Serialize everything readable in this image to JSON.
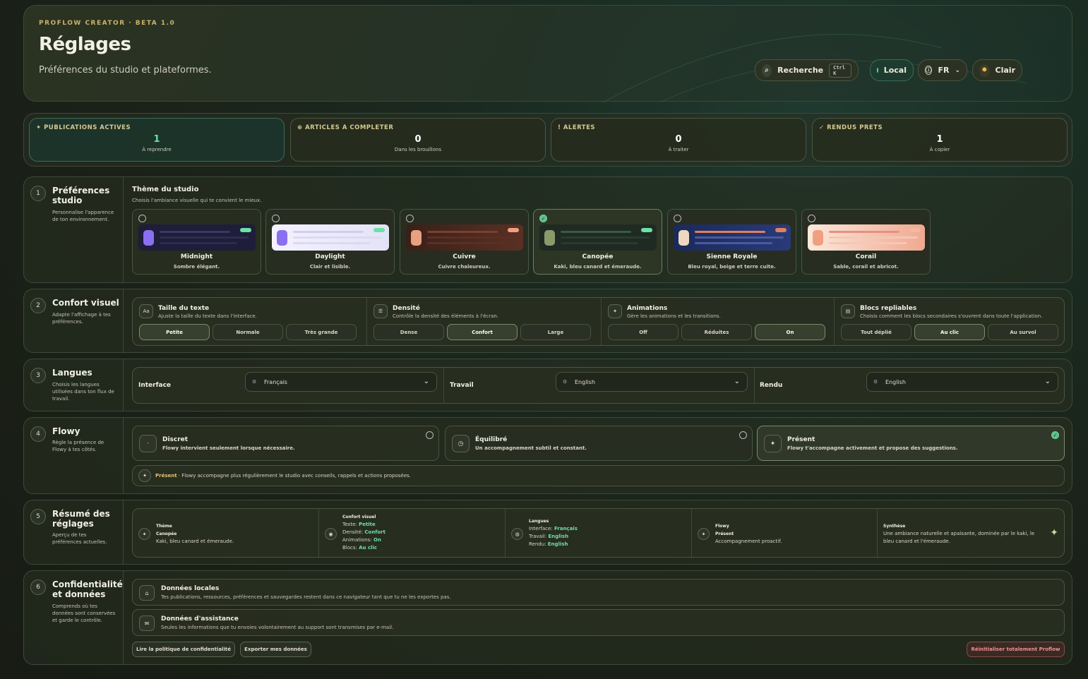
{
  "header": {
    "kicker": "PROFLOW CREATOR · BETA 1.0",
    "title": "Réglages",
    "subtitle": "Préférences du studio et plateformes.",
    "search_label": "Recherche",
    "search_shortcut": "Ctrl K",
    "local_label": "Local",
    "lang_label": "FR",
    "theme_label": "Clair"
  },
  "stats": [
    {
      "label": "✦ PUBLICATIONS ACTIVES",
      "value": "1",
      "note": "À reprendre"
    },
    {
      "label": "⊕ ARTICLES A COMPLETER",
      "value": "0",
      "note": "Dans les brouillons"
    },
    {
      "label": "! ALERTES",
      "value": "0",
      "note": "À traiter"
    },
    {
      "label": "✓ RENDUS PRETS",
      "value": "1",
      "note": "À copier"
    }
  ],
  "sections": {
    "s1": {
      "num": "1",
      "title": "Préférences studio",
      "desc": "Personnalise l'apparence de ton environnement."
    },
    "s2": {
      "num": "2",
      "title": "Confort visuel",
      "desc": "Adapte l'affichage à tes préférences."
    },
    "s3": {
      "num": "3",
      "title": "Langues",
      "desc": "Choisis les langues utilisées dans ton flux de travail."
    },
    "s4": {
      "num": "4",
      "title": "Flowy",
      "desc": "Règle la présence de Flowy à tes côtés."
    },
    "s5": {
      "num": "5",
      "title": "Résumé des réglages",
      "desc": "Aperçu de tes préférences actuelles."
    },
    "s6": {
      "num": "6",
      "title": "Confidentialité et données",
      "desc": "Comprends où tes données sont conservées et garde le contrôle."
    }
  },
  "theme": {
    "heading": "Thème du studio",
    "sub": "Choisis l'ambiance visuelle qui te convient le mieux.",
    "cards": [
      {
        "name": "Midnight",
        "desc": "Sombre élégant."
      },
      {
        "name": "Daylight",
        "desc": "Clair et lisible."
      },
      {
        "name": "Cuivre",
        "desc": "Cuivre chaleureux."
      },
      {
        "name": "Canopée",
        "desc": "Kaki, bleu canard et émeraude."
      },
      {
        "name": "Sienne Royale",
        "desc": "Bleu royal, beige et terre cuite."
      },
      {
        "name": "Corail",
        "desc": "Sable, corail et abricot."
      }
    ]
  },
  "comfort": {
    "text": {
      "icon": "Aa",
      "title": "Taille du texte",
      "desc": "Ajuste la taille du texte dans l'interface.",
      "options": [
        "Petite",
        "Normale",
        "Très grande"
      ]
    },
    "density": {
      "icon": "☰",
      "title": "Densité",
      "desc": "Contrôle la densité des éléments à l'écran.",
      "options": [
        "Dense",
        "Confort",
        "Large"
      ]
    },
    "anim": {
      "icon": "✦",
      "title": "Animations",
      "desc": "Gère les animations et les transitions.",
      "options": [
        "Off",
        "Réduites",
        "On"
      ]
    },
    "blocks": {
      "icon": "▤",
      "title": "Blocs repliables",
      "desc": "Choisis comment les blocs secondaires s'ouvrent dans toute l'application.",
      "options": [
        "Tout déplié",
        "Au clic",
        "Au survol"
      ]
    }
  },
  "languages": {
    "interface": {
      "label": "Interface",
      "value": "Français"
    },
    "work": {
      "label": "Travail",
      "value": "English"
    },
    "render": {
      "label": "Rendu",
      "value": "English"
    }
  },
  "flowy": {
    "options": [
      {
        "title": "Discret",
        "desc": "Flowy intervient seulement lorsque nécessaire."
      },
      {
        "title": "Équilibré",
        "desc": "Un accompagnement subtil et constant."
      },
      {
        "title": "Présent",
        "desc": "Flowy t'accompagne activement et propose des suggestions."
      }
    ],
    "note_strong": "Présent",
    "note": " · Flowy accompagne plus régulièrement le studio avec conseils, rappels et actions proposées."
  },
  "summary": {
    "theme": {
      "h": "Thème",
      "name": "Canopée",
      "desc": "Kaki, bleu canard et émeraude."
    },
    "comfort": {
      "h": "Confort visuel",
      "text_k": "Texte:",
      "text_v": "Petite",
      "density_k": "Densité:",
      "density_v": "Confort",
      "anim_k": "Animations:",
      "anim_v": "On",
      "blocks_k": "Blocs:",
      "blocks_v": "Au clic"
    },
    "langs": {
      "h": "Langues",
      "iface_k": "Interface:",
      "iface_v": "Français",
      "work_k": "Travail:",
      "work_v": "English",
      "render_k": "Rendu:",
      "render_v": "English"
    },
    "flowy": {
      "h": "Flowy",
      "name": "Présent",
      "desc": "Accompagnement proactif."
    },
    "synth": {
      "h": "Synthèse",
      "desc": "Une ambiance naturelle et apaisante, dominée par le kaki, le bleu canard et l'émeraude."
    }
  },
  "privacy": {
    "local": {
      "title": "Données locales",
      "desc": "Tes publications, ressources, préférences et sauvegardes restent dans ce navigateur tant que tu ne les exportes pas."
    },
    "assist": {
      "title": "Données d'assistance",
      "desc": "Seules les informations que tu envoies volontairement au support sont transmises par e-mail."
    },
    "policy_btn": "Lire la politique de confidentialité",
    "export_btn": "Exporter mes données",
    "reset_btn": "Réinitialiser totalement Proflow"
  }
}
